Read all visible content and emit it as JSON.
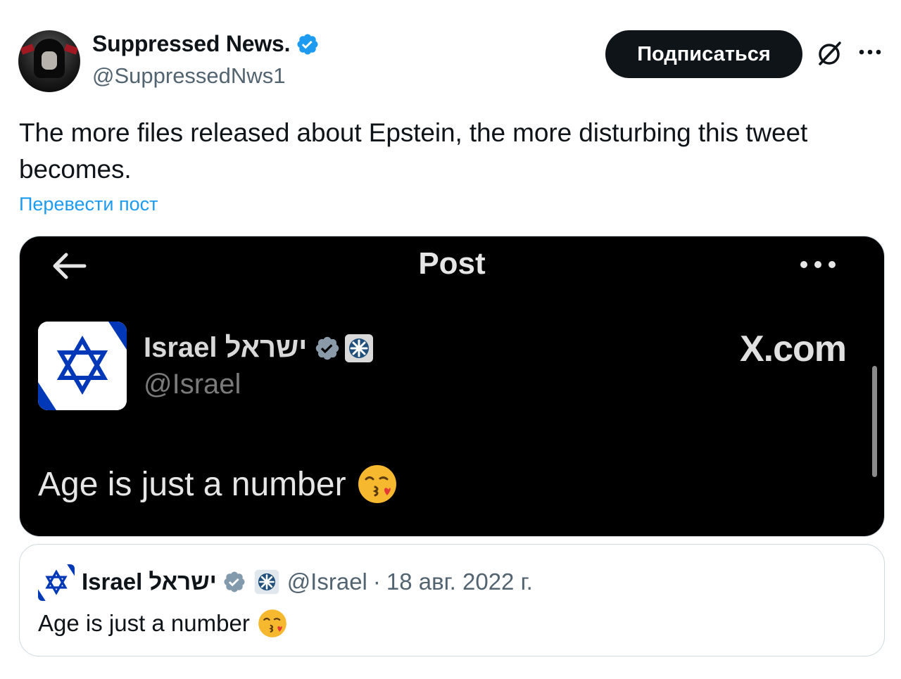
{
  "author": {
    "display_name": "Suppressed News.",
    "handle": "@SuppressedNws1"
  },
  "actions": {
    "subscribe_label": "Подписаться"
  },
  "tweet": {
    "text": "The more files released about Epstein, the more disturbing this tweet becomes.",
    "translate_label": "Перевести пост"
  },
  "media": {
    "header_title": "Post",
    "account_name": "Israel ישראל",
    "account_handle": "@Israel",
    "watermark": "X.com",
    "post_text": "Age is just a number"
  },
  "quote": {
    "name": "Israel ישראל",
    "handle": "@Israel",
    "separator": "·",
    "date": "18 авг. 2022 г.",
    "text": "Age is just a number"
  },
  "colors": {
    "link": "#1d9bf0",
    "verified": "#1d9bf0",
    "text_primary": "#0f1419",
    "text_secondary": "#536471",
    "button_bg": "#0f1419",
    "israel_blue": "#0038b8"
  },
  "icons": {
    "verified": "verified-badge-icon",
    "grok": "grok-icon",
    "more": "more-dots-icon",
    "back": "back-arrow-icon",
    "gov": "government-badge-icon",
    "emoji": "kissing-face-with-heart-emoji-icon"
  }
}
